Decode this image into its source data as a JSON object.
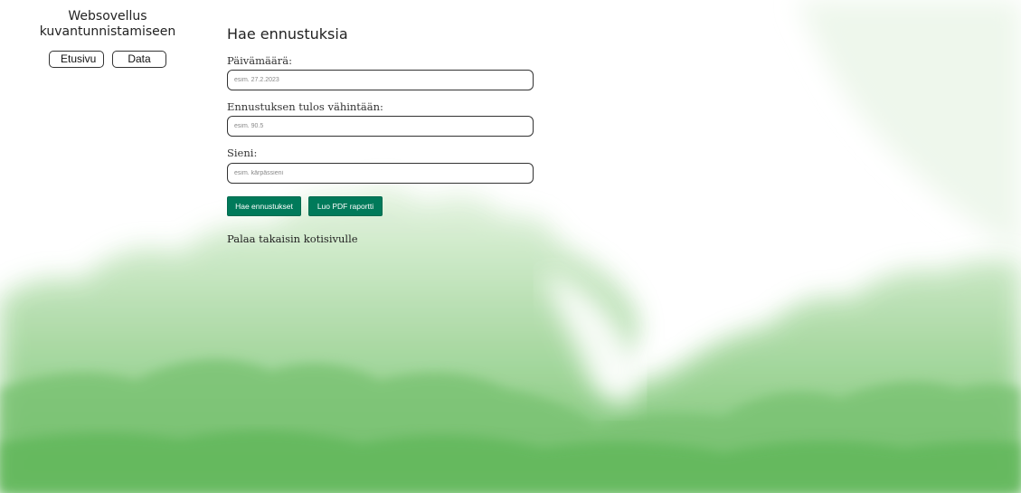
{
  "sidebar": {
    "title_line1": "Websovellus",
    "title_line2": "kuvantunnistamiseen",
    "nav": {
      "home_label": "Etusivu",
      "data_label": "Data"
    }
  },
  "main": {
    "title": "Hae ennustuksia",
    "fields": [
      {
        "label": "Päivämäärä:",
        "placeholder": "esim. 27.2.2023",
        "value": ""
      },
      {
        "label": "Ennustuksen tulos vähintään:",
        "placeholder": "esim. 90.5",
        "value": ""
      },
      {
        "label": "Sieni:",
        "placeholder": "esim. kärpässieni",
        "value": ""
      }
    ],
    "buttons": {
      "search_label": "Hae ennustukset",
      "pdf_label": "Luo PDF raportti"
    },
    "back_link": "Palaa takaisin kotisivulle"
  },
  "colors": {
    "primary_button": "#007a5a",
    "background_accent": "#7cc47a"
  }
}
